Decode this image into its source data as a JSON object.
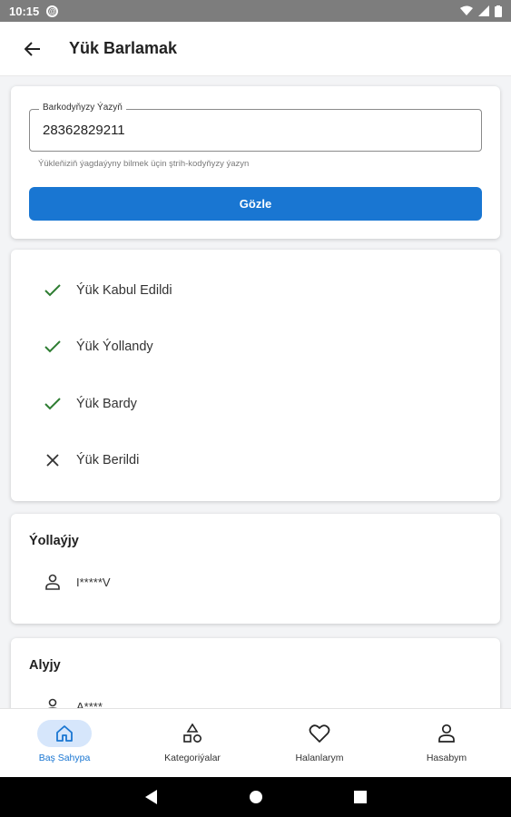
{
  "status_bar": {
    "time": "10:15",
    "notification_glyph": "@"
  },
  "app_bar": {
    "title": "Yük Barlamak"
  },
  "search": {
    "label": "Barkodyňyzy Ýazyň",
    "value": "28362829211",
    "helper": "Ýükleňiziň ýagdaýyny bilmek üçin ştrih-kodyňyzy ýazyn",
    "button": "Gözle"
  },
  "steps": [
    {
      "label": "Ýük Kabul Edildi",
      "state": "done"
    },
    {
      "label": "Ýük Ýollandy",
      "state": "done"
    },
    {
      "label": "Ýük Bardy",
      "state": "done"
    },
    {
      "label": "Ýük Berildi",
      "state": "pending"
    }
  ],
  "sender": {
    "title": "Ýollaýjy",
    "name": "I*****V"
  },
  "receiver": {
    "title": "Alyjy",
    "name": "A****"
  },
  "bottom_nav": [
    {
      "label": "Baş Sahypa",
      "icon": "home-icon",
      "active": true
    },
    {
      "label": "Kategoriýalar",
      "icon": "category-icon",
      "active": false
    },
    {
      "label": "Halanlarym",
      "icon": "heart-icon",
      "active": false
    },
    {
      "label": "Hasabym",
      "icon": "account-icon",
      "active": false
    }
  ],
  "colors": {
    "accent": "#1976d2",
    "check": "#2e7d32",
    "status_bar": "#7d7d7d"
  }
}
